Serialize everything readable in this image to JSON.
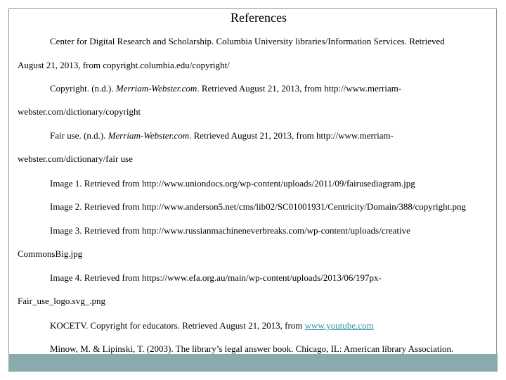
{
  "title": "References",
  "references": [
    {
      "id": "center-digital-research",
      "line1": "Center  for Digital Research and Scholarship. Columbia University libraries/Information Services.  Retrieved",
      "line2": "August 21, 2013, from copyright.columbia.edu/copyright/"
    },
    {
      "id": "copyright-mw",
      "line1_pre": "Copyright. (n.d.). ",
      "line1_italic": "Merriam-Webster.com",
      "line1_post": ". Retrieved August 21, 2013, from http://www.merriam-",
      "line2": "webster.com/dictionary/copyright"
    },
    {
      "id": "fair-use-mw",
      "line1_pre": "Fair use. (n.d.). ",
      "line1_italic": "Merriam-Webster.com",
      "line1_post": ". Retrieved August 21, 2013, from  http://www.merriam-",
      "line2": "webster.com/dictionary/fair use"
    },
    {
      "id": "image-1",
      "line1": "Image 1. Retrieved from http://www.uniondocs.org/wp-content/uploads/2011/09/fairusediagram.jpg"
    },
    {
      "id": "image-2",
      "line1": "Image 2. Retrieved from http://www.anderson5.net/cms/lib02/SC01001931/Centricity/Domain/388/copyright.png"
    },
    {
      "id": "image-3",
      "line1": "Image 3. Retrieved from http://www.russianmachineneverbreaks.com/wp-content/uploads/creative",
      "line2": "CommonsBig.jpg"
    },
    {
      "id": "image-4",
      "line1": "Image 4. Retrieved from https://www.efa.org.au/main/wp-content/uploads/2013/06/197px-",
      "line2": "Fair_use_logo.svg_.png"
    },
    {
      "id": "koce-tv",
      "line1_pre": "KOCETV. Copyright for educators. Retrieved August 21, 2013, from ",
      "line1_link": "www.youtube.com"
    },
    {
      "id": "minow-lipinski",
      "line1": "Minow, M. & Lipinski, T. (2003). The library’s legal answer book. Chicago, IL: American library Association."
    }
  ],
  "colors": {
    "border": "#8c9799",
    "footer_bar": "#8aabad",
    "link": "#2b8fa3",
    "text": "#000000"
  }
}
